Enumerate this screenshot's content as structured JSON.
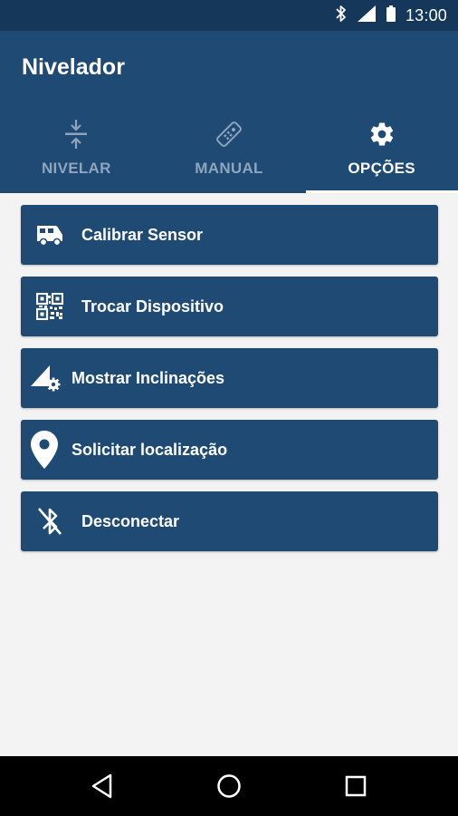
{
  "status_bar": {
    "time": "13:00",
    "icons": [
      "bluetooth-icon",
      "signal-icon",
      "battery-icon"
    ]
  },
  "app_bar": {
    "title": "Nivelador"
  },
  "tabs": [
    {
      "label": "NIVELAR",
      "icon": "level-icon",
      "active": false
    },
    {
      "label": "MANUAL",
      "icon": "remote-icon",
      "active": false
    },
    {
      "label": "OPÇÕES",
      "icon": "gear-icon",
      "active": true
    }
  ],
  "menu": {
    "items": [
      {
        "label": "Calibrar Sensor",
        "icon": "rv-icon"
      },
      {
        "label": "Trocar Dispositivo",
        "icon": "qr-code-icon"
      },
      {
        "label": "Mostrar Inclinações",
        "icon": "incline-settings-icon"
      },
      {
        "label": "Solicitar localização",
        "icon": "location-pin-icon"
      },
      {
        "label": "Desconectar",
        "icon": "bluetooth-disabled-icon"
      }
    ]
  },
  "nav_bar": {
    "buttons": [
      "back-icon",
      "home-icon",
      "recents-icon"
    ]
  },
  "colors": {
    "status_bar": "#153759",
    "app_bar": "#1e4a73",
    "menu_item": "#1f4a73",
    "inactive_tab": "#8ea5bd",
    "background": "#f3f3f3"
  }
}
